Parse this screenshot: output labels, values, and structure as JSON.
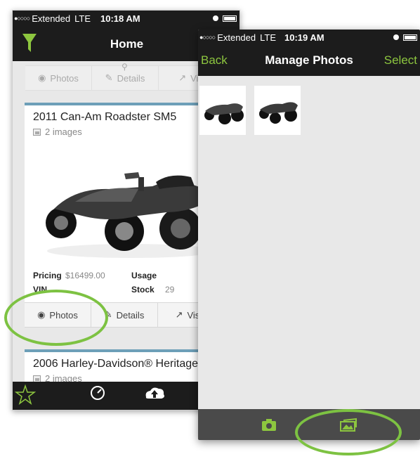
{
  "phone_home": {
    "status": {
      "signal": "●○○○○",
      "carrier": "Extended",
      "network": "LTE",
      "time": "10:18 AM"
    },
    "nav": {
      "title": "Home"
    },
    "top_actions": {
      "photos": "Photos",
      "details": "Details",
      "visibility": "Visi"
    },
    "listing1": {
      "title": "2011 Can-Am Roadster SM5",
      "images": "2 images",
      "pricing_label": "Pricing",
      "pricing_value": "$16499.00",
      "usage_label": "Usage",
      "vin_label": "VIN",
      "stock_label": "Stock",
      "stock_value": "29",
      "actions": {
        "photos": "Photos",
        "details": "Details",
        "visibility": "Visib"
      }
    },
    "listing2": {
      "title": "2006 Harley-Davidson® Heritage",
      "images": "2 images"
    },
    "tabbar": [
      "Favorites",
      "Dashboard",
      "Visibility",
      ""
    ]
  },
  "phone_manage": {
    "status": {
      "signal": "●○○○○",
      "carrier": "Extended",
      "network": "LTE",
      "time": "10:19 AM"
    },
    "nav": {
      "back": "Back",
      "title": "Manage Photos",
      "select": "Select"
    },
    "photos": [
      "photo-1",
      "photo-2"
    ]
  },
  "colors": {
    "accent": "#8dc63f",
    "highlight": "#7dc242",
    "bar": "#1c1c1c",
    "card_top": "#6d9fb8"
  }
}
